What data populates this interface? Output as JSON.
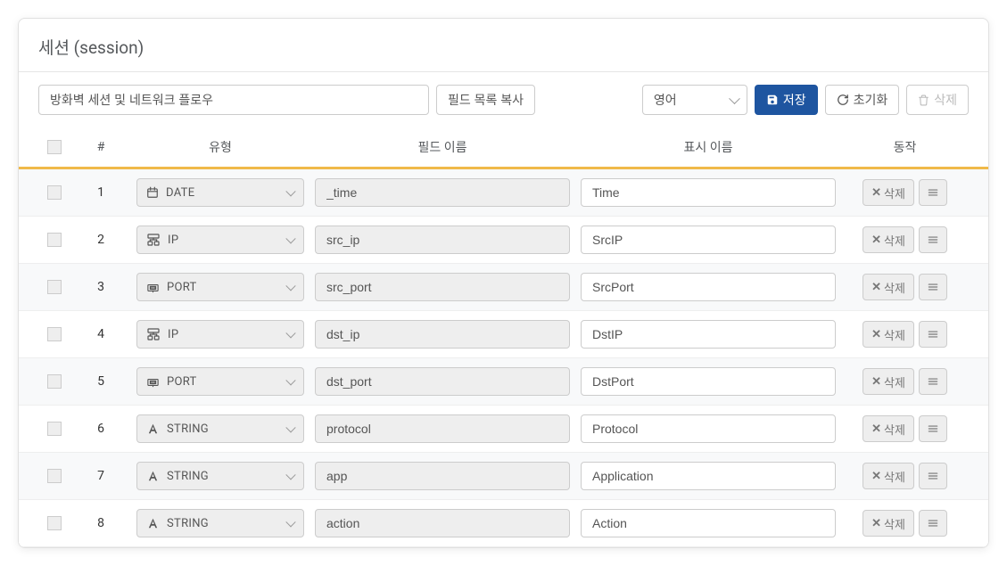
{
  "header": {
    "title": "세션 (session)"
  },
  "toolbar": {
    "description": "방화벽 세션 및 네트워크 플로우",
    "copy_fields_label": "필드 목록 복사",
    "language_selected": "영어",
    "save_label": "저장",
    "reset_label": "초기화",
    "delete_label": "삭제"
  },
  "columns": {
    "index": "#",
    "type": "유형",
    "field_name": "필드 이름",
    "display_name": "표시 이름",
    "action": "동작"
  },
  "row_action": {
    "delete_label": "삭제"
  },
  "type_labels": {
    "DATE": "DATE",
    "IP": "IP",
    "PORT": "PORT",
    "STRING": "STRING"
  },
  "rows": [
    {
      "index": "1",
      "type": "DATE",
      "field": "_time",
      "display": "Time"
    },
    {
      "index": "2",
      "type": "IP",
      "field": "src_ip",
      "display": "SrcIP"
    },
    {
      "index": "3",
      "type": "PORT",
      "field": "src_port",
      "display": "SrcPort"
    },
    {
      "index": "4",
      "type": "IP",
      "field": "dst_ip",
      "display": "DstIP"
    },
    {
      "index": "5",
      "type": "PORT",
      "field": "dst_port",
      "display": "DstPort"
    },
    {
      "index": "6",
      "type": "STRING",
      "field": "protocol",
      "display": "Protocol"
    },
    {
      "index": "7",
      "type": "STRING",
      "field": "app",
      "display": "Application"
    },
    {
      "index": "8",
      "type": "STRING",
      "field": "action",
      "display": "Action"
    }
  ]
}
